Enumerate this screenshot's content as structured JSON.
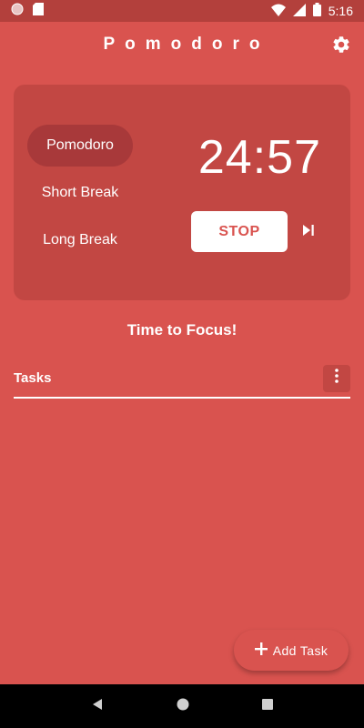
{
  "status_bar": {
    "time": "5:16",
    "icons": [
      "record-icon",
      "sd-card-icon",
      "wifi-icon",
      "signal-icon",
      "battery-icon"
    ]
  },
  "app": {
    "title": "Pomodoro",
    "settings_icon": "gear-icon"
  },
  "timer": {
    "modes": [
      {
        "label": "Pomodoro",
        "active": true
      },
      {
        "label": "Short Break",
        "active": false
      },
      {
        "label": "Long Break",
        "active": false
      }
    ],
    "time": "24:57",
    "stop_label": "STOP",
    "skip_icon": "skip-next-icon"
  },
  "focus_message": "Time to Focus!",
  "tasks": {
    "title": "Tasks",
    "menu_icon": "more-vertical-icon",
    "add_label": "Add Task"
  },
  "colors": {
    "background": "#d9534f",
    "card": "#c24743",
    "active_mode": "#a8393a",
    "status_bar": "#b3403c"
  }
}
